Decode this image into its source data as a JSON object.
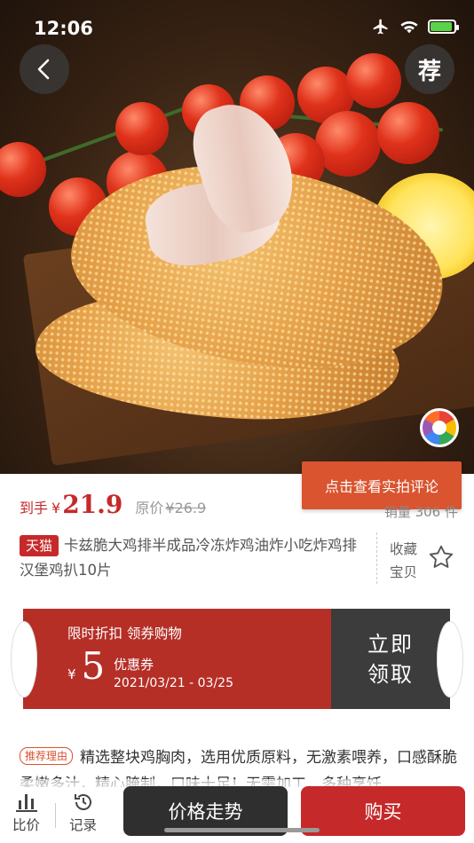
{
  "status_bar": {
    "time": "12:06"
  },
  "header": {
    "back_icon": "chevron-left-icon",
    "recommend_label": "荐"
  },
  "review_popup": {
    "label": "点击查看实拍评论"
  },
  "price": {
    "label": "到手",
    "currency": "¥",
    "value": "21.9",
    "original_label": "原价",
    "original_value": "¥26.9",
    "sales": "销量 306 件"
  },
  "product": {
    "platform_tag": "天猫",
    "title": "卡兹脆大鸡排半成品冷冻炸鸡油炸小吃炸鸡排汉堡鸡扒10片"
  },
  "favorite": {
    "label": "收藏宝贝",
    "icon": "star-outline-icon"
  },
  "coupon": {
    "headline": "限时折扣 领券购物",
    "currency": "¥",
    "amount": "5",
    "name": "优惠券",
    "date_range": "2021/03/21 - 03/25",
    "action_label": "立即领取",
    "colors": {
      "left": "#b52f27",
      "right": "#3c3c3c"
    }
  },
  "recommend": {
    "tag": "推荐理由",
    "text": "精选整块鸡胸肉，选用优质原料，无激素喂养，口感酥脆柔嫩多汁，精心腌制，口味十足！无需加工，多种烹饪"
  },
  "bottom_bar": {
    "compare": {
      "label": "比价",
      "icon": "bar-chart-icon"
    },
    "history": {
      "label": "记录",
      "icon": "history-icon"
    },
    "trend_label": "价格走势",
    "buy_label": "购买"
  },
  "colors": {
    "accent": "#c6292a",
    "popup": "#d9542f",
    "dark": "#2f2f2f"
  }
}
